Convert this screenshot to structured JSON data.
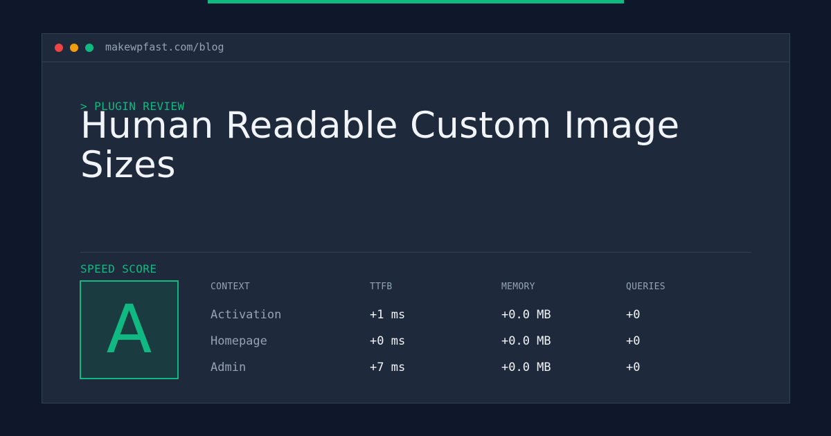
{
  "colors": {
    "accent": "#10b981",
    "dot_red": "#ef4444",
    "dot_yellow": "#f59e0b",
    "dot_green": "#10b981"
  },
  "window": {
    "url": "makewpfast.com/blog"
  },
  "eyebrow": "> PLUGIN REVIEW",
  "title": "Human Readable Custom Image Sizes",
  "speed_score": {
    "label": "SPEED SCORE",
    "grade": "A"
  },
  "metrics": {
    "headers": [
      "CONTEXT",
      "TTFB",
      "MEMORY",
      "QUERIES"
    ],
    "rows": [
      {
        "context": "Activation",
        "ttfb": "+1 ms",
        "memory": "+0.0 MB",
        "queries": "+0"
      },
      {
        "context": "Homepage",
        "ttfb": "+0 ms",
        "memory": "+0.0 MB",
        "queries": "+0"
      },
      {
        "context": "Admin",
        "ttfb": "+7 ms",
        "memory": "+0.0 MB",
        "queries": "+0"
      }
    ]
  }
}
